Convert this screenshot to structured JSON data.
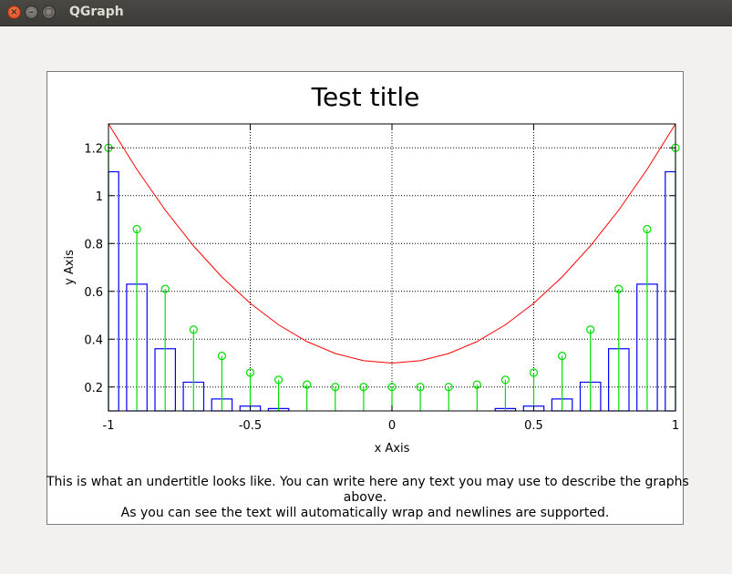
{
  "window": {
    "title": "QGraph"
  },
  "colors": {
    "curve": "#ff0000",
    "bars": "#0000ff",
    "stems": "#00dd00",
    "grid": "#000000"
  },
  "undertitle": {
    "line1": "This is what an undertitle looks like. You can write here any text you may use to describe the graphs",
    "line2": "above.",
    "line3": "As you can see the text will automatically wrap and newlines are supported."
  },
  "chart_data": {
    "type": "line",
    "title": "Test title",
    "xlabel": "x Axis",
    "ylabel": "y Axis",
    "xlim": [
      -1,
      1
    ],
    "ylim": [
      0.1,
      1.3
    ],
    "grid": true,
    "x_ticks": [
      "-1",
      "-0.5",
      "0",
      "0.5",
      "1"
    ],
    "y_ticks": [
      "0.2",
      "0.4",
      "0.6",
      "0.8",
      "1",
      "1.2"
    ],
    "series": [
      {
        "kind": "line",
        "x": [
          -1,
          -0.9,
          -0.8,
          -0.7,
          -0.6,
          -0.5,
          -0.4,
          -0.3,
          -0.2,
          -0.1,
          0,
          0.1,
          0.2,
          0.3,
          0.4,
          0.5,
          0.6,
          0.7,
          0.8,
          0.9,
          1
        ],
        "values": [
          1.3,
          1.11,
          0.94,
          0.79,
          0.66,
          0.55,
          0.46,
          0.39,
          0.34,
          0.31,
          0.3,
          0.31,
          0.34,
          0.39,
          0.46,
          0.55,
          0.66,
          0.79,
          0.94,
          1.11,
          1.3
        ]
      },
      {
        "kind": "bar",
        "x": [
          -1,
          -0.9,
          -0.8,
          -0.7,
          -0.6,
          -0.5,
          -0.4,
          -0.3,
          -0.2,
          -0.1,
          0,
          0.1,
          0.2,
          0.3,
          0.4,
          0.5,
          0.6,
          0.7,
          0.8,
          0.9,
          1
        ],
        "values": [
          1.1,
          0.63,
          0.36,
          0.22,
          0.15,
          0.12,
          0.11,
          0.1,
          0.1,
          0.1,
          0.1,
          0.1,
          0.1,
          0.1,
          0.11,
          0.12,
          0.15,
          0.22,
          0.36,
          0.63,
          1.1
        ]
      },
      {
        "kind": "stem",
        "x": [
          -1,
          -0.9,
          -0.8,
          -0.7,
          -0.6,
          -0.5,
          -0.4,
          -0.3,
          -0.2,
          -0.1,
          0,
          0.1,
          0.2,
          0.3,
          0.4,
          0.5,
          0.6,
          0.7,
          0.8,
          0.9,
          1
        ],
        "values": [
          1.2,
          0.86,
          0.61,
          0.44,
          0.33,
          0.26,
          0.23,
          0.21,
          0.2,
          0.2,
          0.2,
          0.2,
          0.2,
          0.21,
          0.23,
          0.26,
          0.33,
          0.44,
          0.61,
          0.86,
          1.2
        ]
      }
    ]
  }
}
